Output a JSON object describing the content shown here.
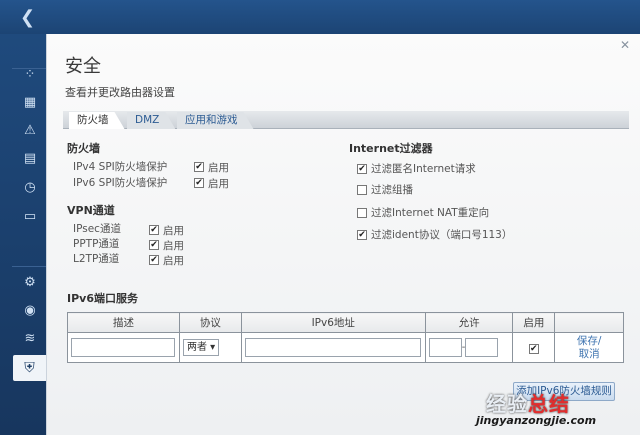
{
  "nav": {
    "back_icon": "chevron-left-icon"
  },
  "rail": {
    "icons": [
      "network-map-icon",
      "calendar-icon",
      "alert-icon",
      "devices-icon",
      "clock-icon",
      "media-icon",
      "settings-icon",
      "diagnostics-icon",
      "wireless-icon",
      "security-shield-icon"
    ]
  },
  "panel": {
    "close": "✕",
    "title": "安全",
    "subtitle": "查看并更改路由器设置",
    "tabs": [
      "防火墙",
      "DMZ",
      "应用和游戏"
    ],
    "firewall": {
      "heading": "防火墙",
      "rows": [
        {
          "label": "IPv4 SPI防火墙保护",
          "check_label": "启用",
          "checked": true
        },
        {
          "label": "IPv6 SPI防火墙保护",
          "check_label": "启用",
          "checked": true
        }
      ]
    },
    "vpn": {
      "heading": "VPN通道",
      "rows": [
        {
          "label": "IPsec通道",
          "check_label": "启用",
          "checked": true
        },
        {
          "label": "PPTP通道",
          "check_label": "启用",
          "checked": true
        },
        {
          "label": "L2TP通道",
          "check_label": "启用",
          "checked": true
        }
      ]
    },
    "internet_filter": {
      "heading": "Internet过滤器",
      "rows": [
        {
          "label": "过滤匿名Internet请求",
          "checked": true
        },
        {
          "label": "过滤组播",
          "checked": false
        },
        {
          "label": "过滤Internet NAT重定向",
          "checked": false
        },
        {
          "label": "过滤ident协议（端口号113）",
          "checked": true
        }
      ]
    },
    "ipv6_ports": {
      "heading": "IPv6端口服务",
      "columns": [
        "描述",
        "协议",
        "IPv6地址",
        "允许",
        "启用"
      ],
      "row": {
        "description": "",
        "protocol": "两者",
        "ipv6_address": "",
        "port_from": "",
        "port_sep": "-",
        "enabled": true,
        "save": "保存/",
        "cancel": "取消"
      }
    },
    "add_button": "添加IPv6防火墙规则"
  },
  "watermark": {
    "text1": "经验",
    "text2": "总结",
    "url": "jingyanzongjie.com"
  }
}
